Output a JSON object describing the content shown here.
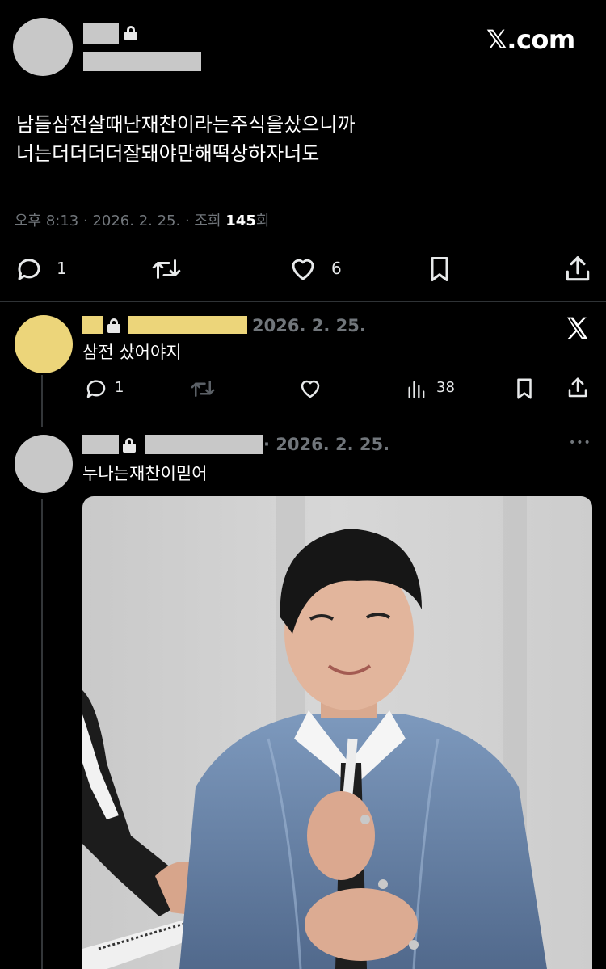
{
  "brand": {
    "logo_text": "𝕏.com"
  },
  "main_tweet": {
    "text_line1": "남들삼전살때난재찬이라는주식을샀으니까",
    "text_line2": "너는더더더더잘돼야만해떡상하자너도",
    "meta_time": "오후 8:13",
    "meta_date": "2026. 2. 25.",
    "meta_views_label": "조회",
    "meta_views_count": "145",
    "meta_views_unit": "회",
    "actions": {
      "replies": "1",
      "likes": "6"
    }
  },
  "reply_1": {
    "date": "2026. 2. 25.",
    "text": "삼전 샀어야지",
    "actions": {
      "replies": "1",
      "views": "38"
    },
    "avatar_color": "#ecd57a"
  },
  "reply_2": {
    "date": "2026. 2. 25.",
    "text": "누나는재찬이믿어",
    "more": "•••"
  },
  "colors": {
    "background": "#000000",
    "text": "#ffffff",
    "muted": "#71767b",
    "redacted": "#c8c8c8",
    "highlight": "#ecd57a"
  }
}
